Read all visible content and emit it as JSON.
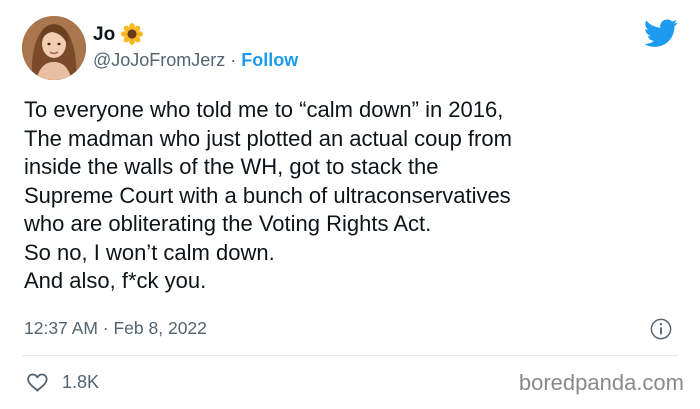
{
  "author": {
    "display_name": "Jo",
    "name_emoji_icon": "sunflower-icon",
    "handle": "@JoJoFromJerz",
    "separator": "·",
    "follow_label": "Follow"
  },
  "brand": {
    "icon": "twitter-bird-icon",
    "accent_color": "#1d9bf0"
  },
  "tweet": {
    "lines": [
      "To everyone who told me to “calm down” in 2016,",
      "The madman who just plotted an actual coup from",
      "inside the walls of the WH, got to stack the",
      "Supreme Court with a bunch of ultraconservatives",
      "who are obliterating the Voting Rights Act.",
      "So no, I won’t calm down.",
      "And also, f*ck you."
    ],
    "timestamp": "12:37 AM · Feb 8, 2022",
    "info_icon": "info-icon"
  },
  "engagement": {
    "like_icon": "heart-icon",
    "likes": "1.8K"
  },
  "watermark": "boredpanda.com"
}
